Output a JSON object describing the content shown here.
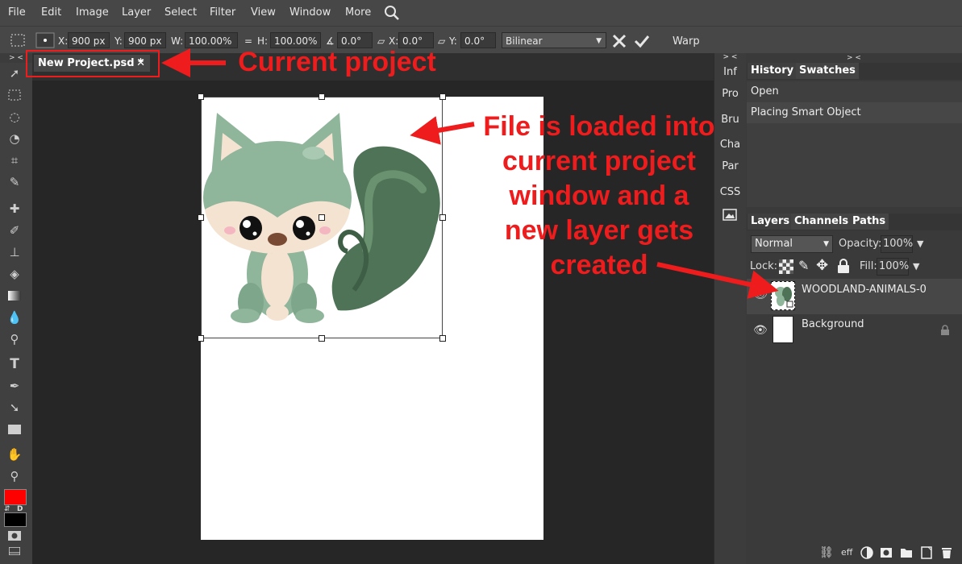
{
  "menubar": {
    "items": [
      "File",
      "Edit",
      "Image",
      "Layer",
      "Select",
      "Filter",
      "View",
      "Window",
      "More"
    ]
  },
  "options": {
    "x_label": "X:",
    "x_value": "900 px",
    "y_label": "Y:",
    "y_value": "900 px",
    "w_label": "W:",
    "w_value": "100.00%",
    "h_label": "H:",
    "h_value": "100.00%",
    "angle_value": "0.0°",
    "skew_x_label": "X:",
    "skew_x_value": "0.0°",
    "skew_y_label": "Y:",
    "skew_y_value": "0.0°",
    "interp_value": "Bilinear",
    "warp_label": "Warp"
  },
  "collapse_toggle": "> <",
  "document_tab": {
    "title": "New Project.psd *",
    "close": "✕"
  },
  "mini_panel": {
    "items": [
      "Inf",
      "Pro",
      "Bru",
      "Cha",
      "Par",
      "CSS"
    ]
  },
  "history_panel": {
    "tabs": [
      "History",
      "Swatches"
    ],
    "entries": [
      "Open",
      "Placing Smart Object"
    ]
  },
  "layers_panel": {
    "tabs": [
      "Layers",
      "Channels",
      "Paths"
    ],
    "blend_mode": "Normal",
    "opacity_label": "Opacity:",
    "opacity_value": "100%",
    "lock_label": "Lock:",
    "fill_label": "Fill:",
    "fill_value": "100%",
    "layers": [
      {
        "name": "WOODLAND-ANIMALS-0"
      },
      {
        "name": "Background"
      }
    ],
    "footer_eff": "eff"
  },
  "annotations": {
    "current_project": "Current project",
    "file_loaded": [
      "File is loaded into",
      "current project",
      "window and a",
      "new layer gets",
      "created"
    ]
  },
  "colors": {
    "foreground": "#ff0000",
    "background": "#000000",
    "annotation": "#ee1c1c"
  }
}
